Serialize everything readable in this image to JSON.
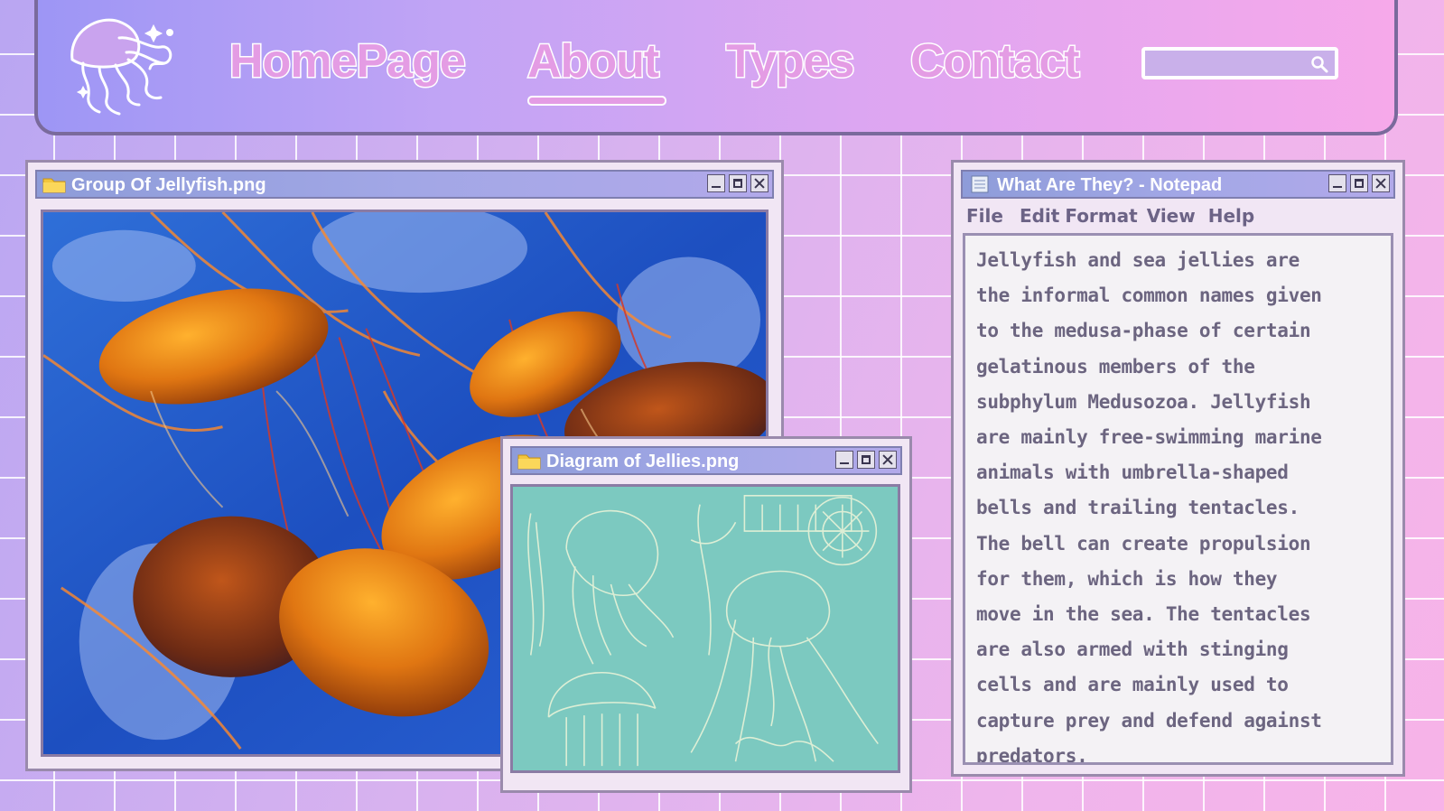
{
  "nav": {
    "links": {
      "home": "HomePage",
      "about": "About",
      "types": "Types",
      "contact": "Contact"
    },
    "active": "About",
    "search": {
      "placeholder": "",
      "value": ""
    },
    "logo_icon": "jellyfish-logo-icon",
    "search_icon": "search-icon"
  },
  "windows": {
    "photo": {
      "title": "Group Of Jellyfish.png",
      "icon": "folder-icon",
      "image": "photo of orange jellyfish on blue water"
    },
    "diagram": {
      "title": "Diagram of Jellies.png",
      "icon": "folder-icon",
      "image": "teal illustration of jellies"
    },
    "notepad": {
      "title": "What Are They? - Notepad",
      "icon": "notepad-icon",
      "menu": [
        "File",
        "Edit",
        "Format",
        "View",
        "Help"
      ],
      "body": "Jellyfish and sea jellies are\nthe informal common names given\nto the medusa-phase of certain\ngelatinous members of the\nsubphylum Medusozoa. Jellyfish\nare mainly free-swimming marine\nanimals with umbrella-shaped\nbells and trailing tentacles.\nThe bell can create propulsion\nfor them, which is how they\nmove in the sea. The tentacles\nare also armed with stinging\ncells and are mainly used to\ncapture prey and defend against\npredators."
    }
  },
  "colors": {
    "nav_link": "#e49ce4",
    "titlebar": "#a2a7e6",
    "notepad_text": "#6c6580"
  }
}
